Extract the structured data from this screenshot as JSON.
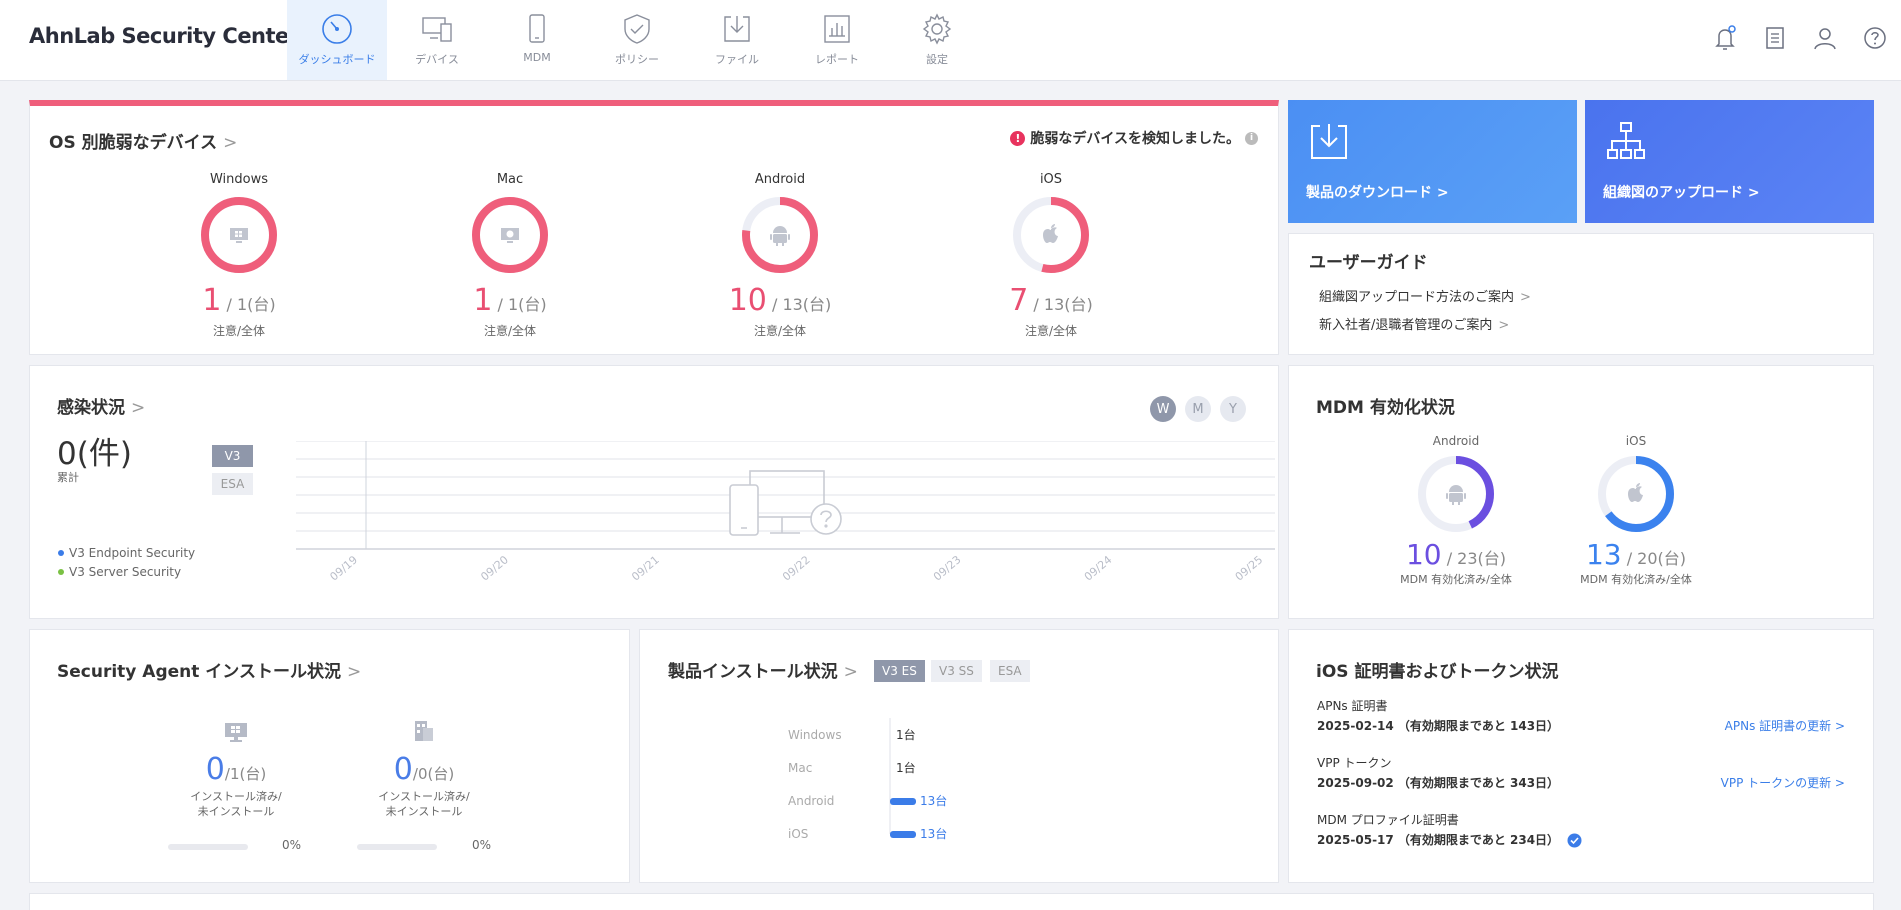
{
  "app": {
    "title": "AhnLab Security Center"
  },
  "nav": [
    {
      "label": "ダッシュボード",
      "icon": "dashboard-gauge-icon",
      "active": true
    },
    {
      "label": "デバイス",
      "icon": "devices-icon",
      "active": false
    },
    {
      "label": "MDM",
      "icon": "mobile-phone-icon",
      "active": false
    },
    {
      "label": "ポリシー",
      "icon": "shield-check-icon",
      "active": false
    },
    {
      "label": "ファイル",
      "icon": "file-download-icon",
      "active": false
    },
    {
      "label": "レポート",
      "icon": "report-chart-icon",
      "active": false
    },
    {
      "label": "設定",
      "icon": "gear-icon",
      "active": false
    }
  ],
  "os_card": {
    "title": "OS 別脆弱なデバイス",
    "alert": "脆弱なデバイスを検知しました。",
    "items": [
      {
        "name": "Windows",
        "count": "1",
        "total": "/ 1(台)",
        "sub": "注意/全体",
        "ratio": 1.0
      },
      {
        "name": "Mac",
        "count": "1",
        "total": "/ 1(台)",
        "sub": "注意/全体",
        "ratio": 1.0
      },
      {
        "name": "Android",
        "count": "10",
        "total": "/ 13(台)",
        "sub": "注意/全体",
        "ratio": 0.77
      },
      {
        "name": "iOS",
        "count": "7",
        "total": "/ 13(台)",
        "sub": "注意/全体",
        "ratio": 0.54
      }
    ]
  },
  "tiles": {
    "download": "製品のダウンロード >",
    "org_upload": "組織図のアップロード >"
  },
  "guide": {
    "title": "ユーザーガイド",
    "items": [
      "組織図アップロード方法のご案内",
      "新入社者/退職者管理のご案内"
    ]
  },
  "infection": {
    "title": "感染状況",
    "count": "0(件)",
    "sub": "累計",
    "periods": [
      "W",
      "M",
      "Y"
    ],
    "tags": [
      "V3",
      "ESA"
    ],
    "legend": [
      {
        "name": "V3 Endpoint Security",
        "color": "#3b7ce8"
      },
      {
        "name": "V3 Server Security",
        "color": "#7ac143"
      }
    ],
    "chart_data": {
      "type": "line",
      "x": [
        "09/19",
        "09/20",
        "09/21",
        "09/22",
        "09/23",
        "09/24",
        "09/25"
      ],
      "series": []
    }
  },
  "mdm": {
    "title": "MDM 有効化状況",
    "items": [
      {
        "name": "Android",
        "count": "10",
        "total": "/ 23(台)",
        "sub": "MDM 有効化済み/全体",
        "ratio": 0.43,
        "color": "#6b4fe0"
      },
      {
        "name": "iOS",
        "count": "13",
        "total": "/ 20(台)",
        "sub": "MDM 有効化済み/全体",
        "ratio": 0.65,
        "color": "#3b82ee"
      }
    ]
  },
  "agent": {
    "title": "Security Agent インストール状況",
    "items": [
      {
        "count": "0",
        "total": "/1(台)",
        "sub1": "インストール済み/",
        "sub2": "未インストール",
        "pct": "0%"
      },
      {
        "count": "0",
        "total": "/0(台)",
        "sub1": "インストール済み/",
        "sub2": "未インストール",
        "pct": "0%"
      }
    ]
  },
  "product": {
    "title": "製品インストール状況",
    "tabs": [
      "V3 ES",
      "V3 SS",
      "ESA"
    ],
    "chart_data": {
      "type": "bar",
      "categories": [
        "Windows",
        "Mac",
        "Android",
        "iOS"
      ],
      "values": [
        1,
        1,
        13,
        13
      ],
      "labels": [
        "1台",
        "1台",
        "13台",
        "13台"
      ]
    }
  },
  "ios_cert": {
    "title": "iOS 証明書およびトークン状況",
    "items": [
      {
        "label": "APNs 証明書",
        "date": "2025-02-14 （有効期限まであと 143日）",
        "link": "APNs 証明書の更新 >"
      },
      {
        "label": "VPP トークン",
        "date": "2025-09-02 （有効期限まであと 343日）",
        "link": "VPP トークンの更新 >"
      },
      {
        "label": "MDM プロファイル証明書",
        "date": "2025-05-17 （有効期限まであと 234日）",
        "link": ""
      }
    ]
  }
}
